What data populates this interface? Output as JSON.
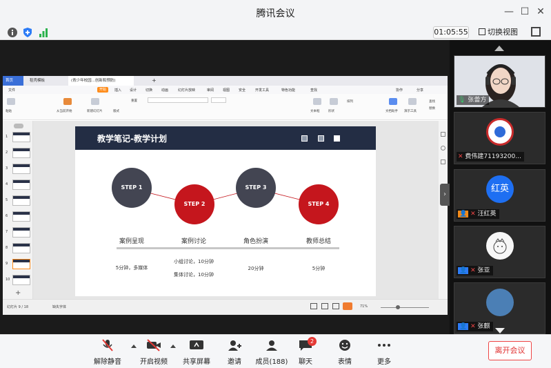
{
  "window": {
    "title": "腾讯会议"
  },
  "infobar": {
    "timer": "01:05:55",
    "switch_view": "切换视图"
  },
  "ppt": {
    "tabs": [
      "首页",
      "稻壳模板",
      "(青少年校园...创新和预防)"
    ],
    "menu": [
      "文件",
      "开始",
      "插入",
      "设计",
      "切换",
      "动画",
      "幻灯片放映",
      "审阅",
      "视图",
      "安全",
      "开发工具",
      "特色功能",
      "查找"
    ],
    "menu_right": [
      "协作",
      "分享"
    ],
    "ribbon_labels": [
      "粘贴",
      "从当前开始",
      "新建幻灯片",
      "版式",
      "重置",
      "文本框",
      "形状",
      "排列",
      "文档助手",
      "演示工具",
      "查找",
      "替换"
    ],
    "slide_numbers": [
      "1",
      "2",
      "3",
      "4",
      "5",
      "6",
      "7",
      "8",
      "9",
      "10"
    ],
    "status_left": "幻灯片 9 / 18",
    "status_font": "缺失字体",
    "zoom": "71%",
    "slide": {
      "title": "教学笔记-教学计划",
      "steps": [
        "STEP 1",
        "STEP 2",
        "STEP 3",
        "STEP 4"
      ],
      "phases": [
        "案例呈现",
        "案例讨论",
        "角色扮演",
        "教师总结"
      ],
      "desc1": "5分钟，多媒体",
      "desc2a": "小组讨论，10分钟",
      "desc2b": "集体讨论，10分钟",
      "desc3": "20分钟",
      "desc4": "5分钟"
    }
  },
  "participants": [
    {
      "name": "张蕾方"
    },
    {
      "name": "费伟建71193200..."
    },
    {
      "name": "汪红英",
      "avatar_text": "红英"
    },
    {
      "name": "张亚"
    },
    {
      "name": "张麒"
    }
  ],
  "toolbar": {
    "mute": "解除静音",
    "video": "开启视频",
    "share": "共享屏幕",
    "invite": "邀请",
    "members": "成员(188)",
    "chat": "聊天",
    "chat_badge": "2",
    "emoji": "表情",
    "more": "更多",
    "leave": "离开会议"
  },
  "colors": {
    "accent_red": "#c5161d",
    "slide_dark": "#232d44",
    "leave_red": "#e03030"
  }
}
